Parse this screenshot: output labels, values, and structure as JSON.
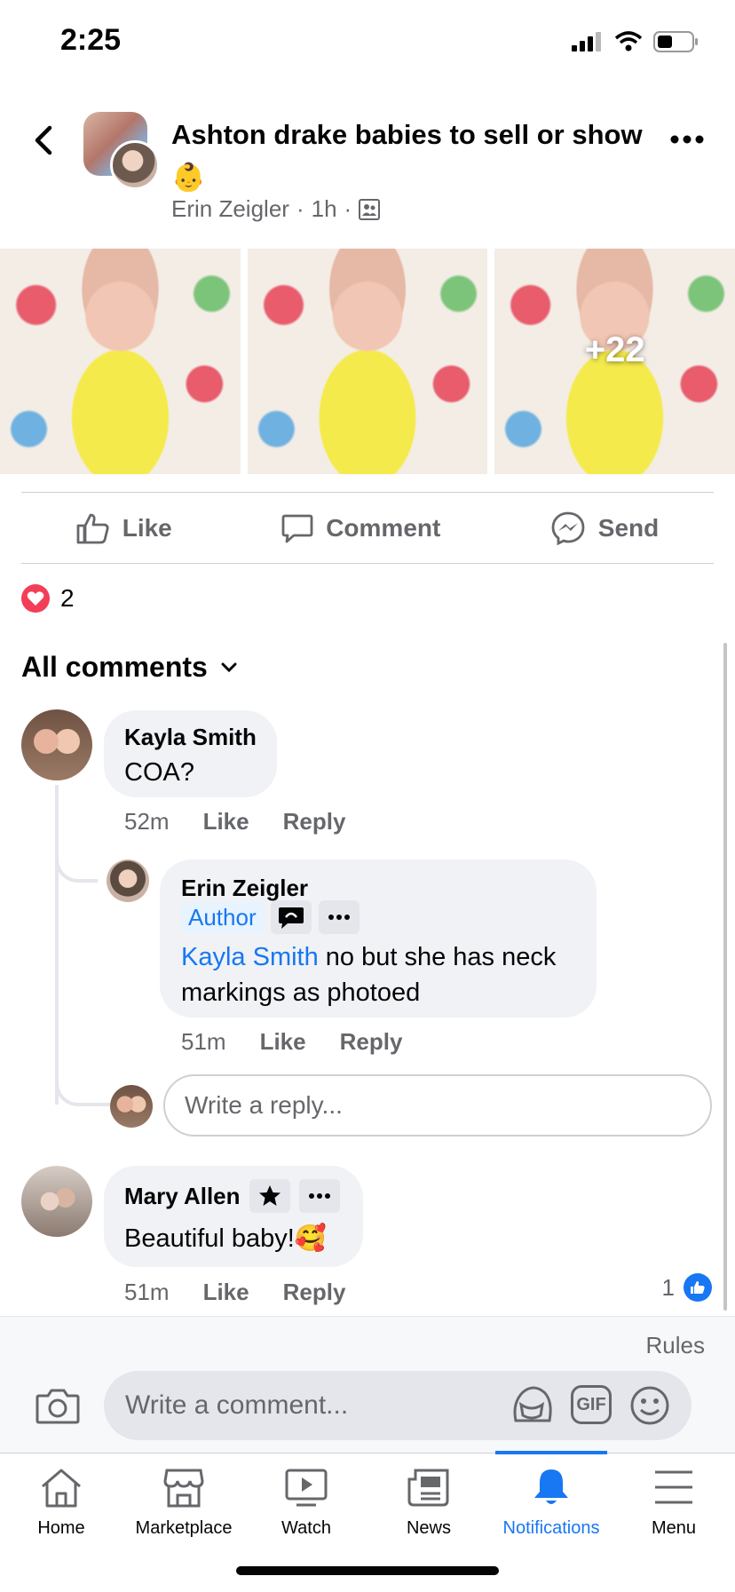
{
  "status_bar": {
    "time": "2:25"
  },
  "post": {
    "title": "Ashton drake babies to sell or show 👶",
    "author": "Erin Zeigler",
    "time": "1h",
    "more_photos": "+22",
    "reaction_count": "2"
  },
  "actions": {
    "like": "Like",
    "comment": "Comment",
    "send": "Send"
  },
  "comments_header": {
    "label": "All comments"
  },
  "comments": [
    {
      "name": "Kayla Smith",
      "text": "COA?",
      "time": "52m",
      "like": "Like",
      "reply": "Reply"
    },
    {
      "name": "Erin Zeigler",
      "badge": "Author",
      "mention": "Kayla Smith",
      "text": " no but she has neck markings as photoed",
      "time": "51m",
      "like": "Like",
      "reply": "Reply"
    },
    {
      "name": "Mary Allen",
      "text": "Beautiful baby!🥰",
      "time": "51m",
      "like": "Like",
      "reply": "Reply",
      "like_count": "1"
    }
  ],
  "reply_input": {
    "placeholder": "Write a reply..."
  },
  "comment_bar": {
    "rules": "Rules",
    "placeholder": "Write a comment...",
    "gif": "GIF"
  },
  "tabs": [
    {
      "label": "Home",
      "icon": "home-icon"
    },
    {
      "label": "Marketplace",
      "icon": "marketplace-icon"
    },
    {
      "label": "Watch",
      "icon": "watch-icon"
    },
    {
      "label": "News",
      "icon": "news-icon"
    },
    {
      "label": "Notifications",
      "icon": "bell-icon",
      "active": true
    },
    {
      "label": "Menu",
      "icon": "menu-icon"
    }
  ],
  "colors": {
    "accent": "#1877f2",
    "bubble": "#f0f2f5",
    "secondary_text": "#65676b",
    "heart": "#f33e58"
  }
}
